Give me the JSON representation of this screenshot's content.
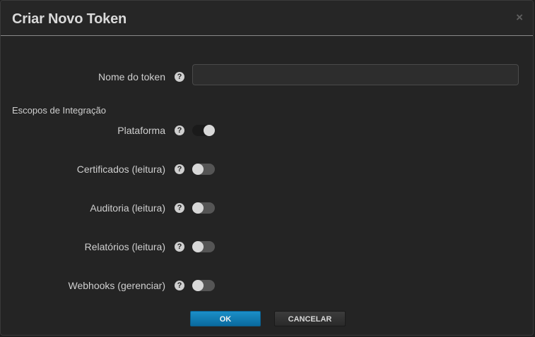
{
  "dialog": {
    "title": "Criar Novo Token",
    "close_icon": "×"
  },
  "token_name": {
    "label": "Nome do token",
    "value": "",
    "placeholder": ""
  },
  "help_icon": "?",
  "scopes": {
    "title": "Escopos de Integração",
    "items": [
      {
        "label": "Plataforma",
        "enabled": true
      },
      {
        "label": "Certificados (leitura)",
        "enabled": false
      },
      {
        "label": "Auditoria (leitura)",
        "enabled": false
      },
      {
        "label": "Relatórios (leitura)",
        "enabled": false
      },
      {
        "label": "Webhooks (gerenciar)",
        "enabled": false
      }
    ]
  },
  "buttons": {
    "ok": "OK",
    "cancel": "CANCELAR"
  }
}
